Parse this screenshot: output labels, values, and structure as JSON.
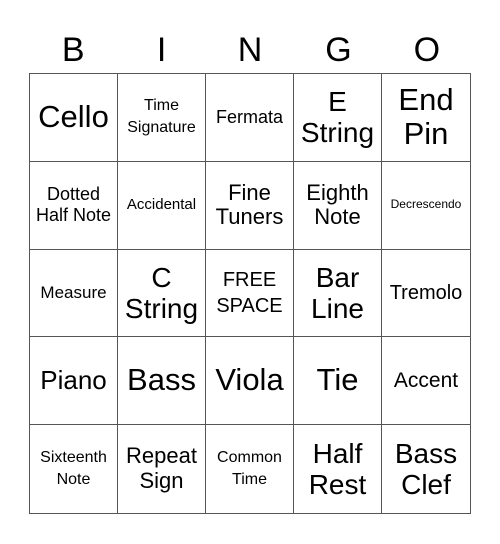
{
  "header": {
    "letters": [
      "B",
      "I",
      "N",
      "G",
      "O"
    ]
  },
  "cells": [
    "Cello",
    "Time Signature",
    "Fermata",
    "E String",
    "End Pin",
    "Dotted Half Note",
    "Accidental",
    "Fine Tuners",
    "Eighth Note",
    "Decrescendo",
    "Measure",
    "C String",
    "FREE SPACE",
    "Bar Line",
    "Tremolo",
    "Piano",
    "Bass",
    "Viola",
    "Tie",
    "Accent",
    "Sixteenth Note",
    "Repeat Sign",
    "Common Time",
    "Half Rest",
    "Bass Clef"
  ]
}
